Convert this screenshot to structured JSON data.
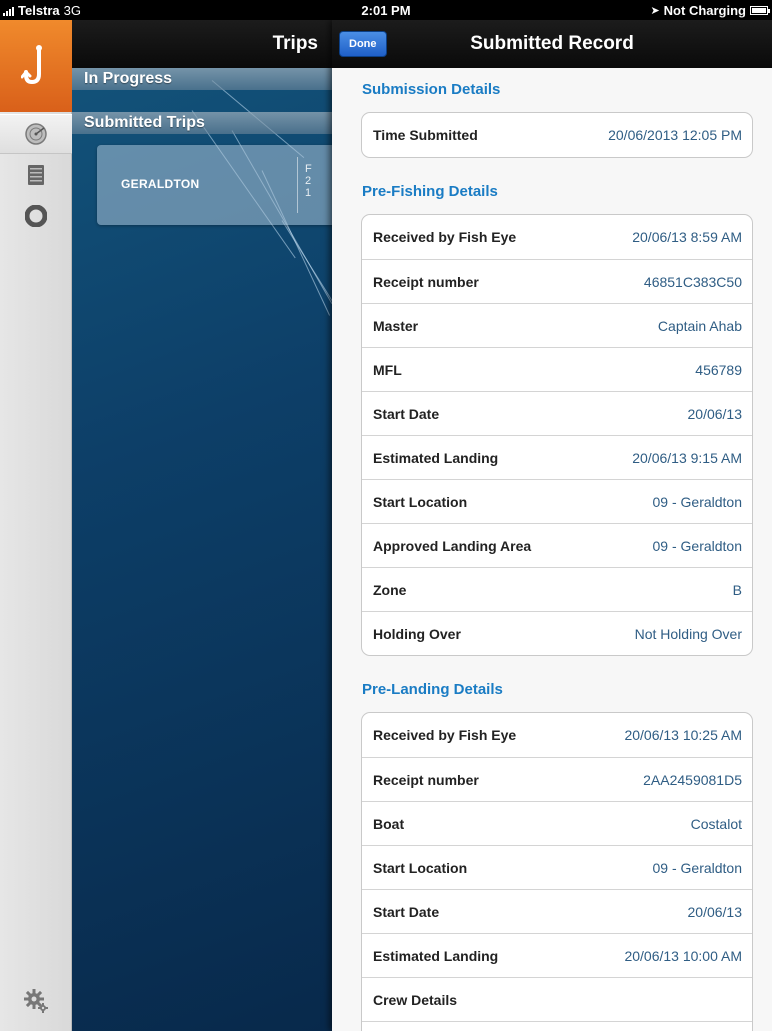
{
  "status_bar": {
    "carrier": "Telstra",
    "network": "3G",
    "time": "2:01 PM",
    "charging": "Not Charging"
  },
  "trips_panel": {
    "title": "Trips",
    "sections": [
      {
        "label": "In Progress"
      },
      {
        "label": "Submitted Trips"
      }
    ],
    "trip_card": {
      "name": "GERALDTON",
      "peek": [
        "F",
        "2",
        "1"
      ]
    }
  },
  "detail_panel": {
    "done_label": "Done",
    "title": "Submitted Record",
    "groups": [
      {
        "title": "Submission Details",
        "rows": [
          {
            "label": "Time Submitted",
            "value": "20/06/2013 12:05 PM"
          }
        ]
      },
      {
        "title": "Pre-Fishing Details",
        "rows": [
          {
            "label": "Received by Fish Eye",
            "value": "20/06/13 8:59 AM"
          },
          {
            "label": "Receipt number",
            "value": "46851C383C50"
          },
          {
            "label": "Master",
            "value": "Captain Ahab"
          },
          {
            "label": "MFL",
            "value": "456789"
          },
          {
            "label": "Start Date",
            "value": "20/06/13"
          },
          {
            "label": "Estimated Landing",
            "value": "20/06/13 9:15 AM"
          },
          {
            "label": "Start Location",
            "value": "09 - Geraldton"
          },
          {
            "label": "Approved Landing Area",
            "value": "09 - Geraldton"
          },
          {
            "label": "Zone",
            "value": "B"
          },
          {
            "label": "Holding Over",
            "value": "Not Holding Over"
          }
        ]
      },
      {
        "title": "Pre-Landing Details",
        "rows": [
          {
            "label": "Received by Fish Eye",
            "value": "20/06/13 10:25 AM"
          },
          {
            "label": "Receipt number",
            "value": "2AA2459081D5"
          },
          {
            "label": "Boat",
            "value": "Costalot"
          },
          {
            "label": "Start Location",
            "value": "09 - Geraldton"
          },
          {
            "label": "Start Date",
            "value": "20/06/13"
          },
          {
            "label": "Estimated Landing",
            "value": "20/06/13 10:00 AM"
          },
          {
            "label": "Crew Details",
            "value": ""
          },
          {
            "label": "",
            "value": ""
          }
        ]
      }
    ]
  },
  "icons": {
    "rail": [
      "fish-hook-icon",
      "radar-icon",
      "list-icon",
      "lifebuoy-icon",
      "settings-gear-icon"
    ],
    "accent_color": "#e8751f",
    "link_color": "#1a7cc4"
  }
}
